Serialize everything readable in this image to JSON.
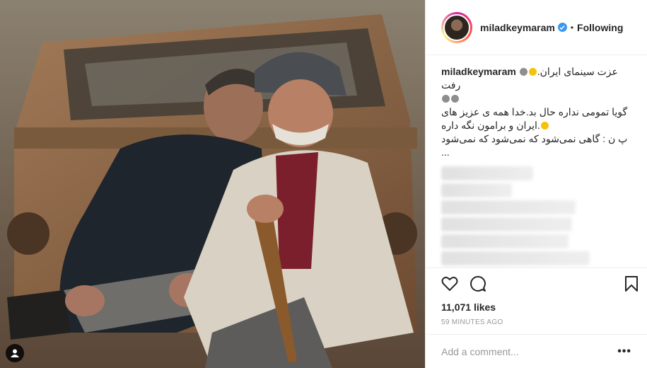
{
  "post": {
    "username": "miladkeymaram",
    "separator": "•",
    "follow_label": "Following",
    "caption_username": "miladkeymaram",
    "caption_line1": ".عزت سینمای ایران رفت",
    "caption_line2": "گویا تمومی نداره حال بد.خدا همه ی عزیز های",
    "caption_line3": ".ایران و برامون نگه داره",
    "caption_line4": "پ ن : گاهی نمی‌شود که نمی‌شود که نمی‌شود",
    "caption_more": "...",
    "likes": "11,071 likes",
    "time": "59 MINUTES AGO",
    "comment_placeholder": "Add a comment...",
    "more_options": "•••"
  },
  "icons": {
    "verified": "verified-badge-icon",
    "like": "heart-icon",
    "comment": "comment-icon",
    "save": "bookmark-icon",
    "tag": "user-tag-icon"
  },
  "colors": {
    "verified": "#3897f0",
    "text": "#262626",
    "muted": "#999999"
  }
}
